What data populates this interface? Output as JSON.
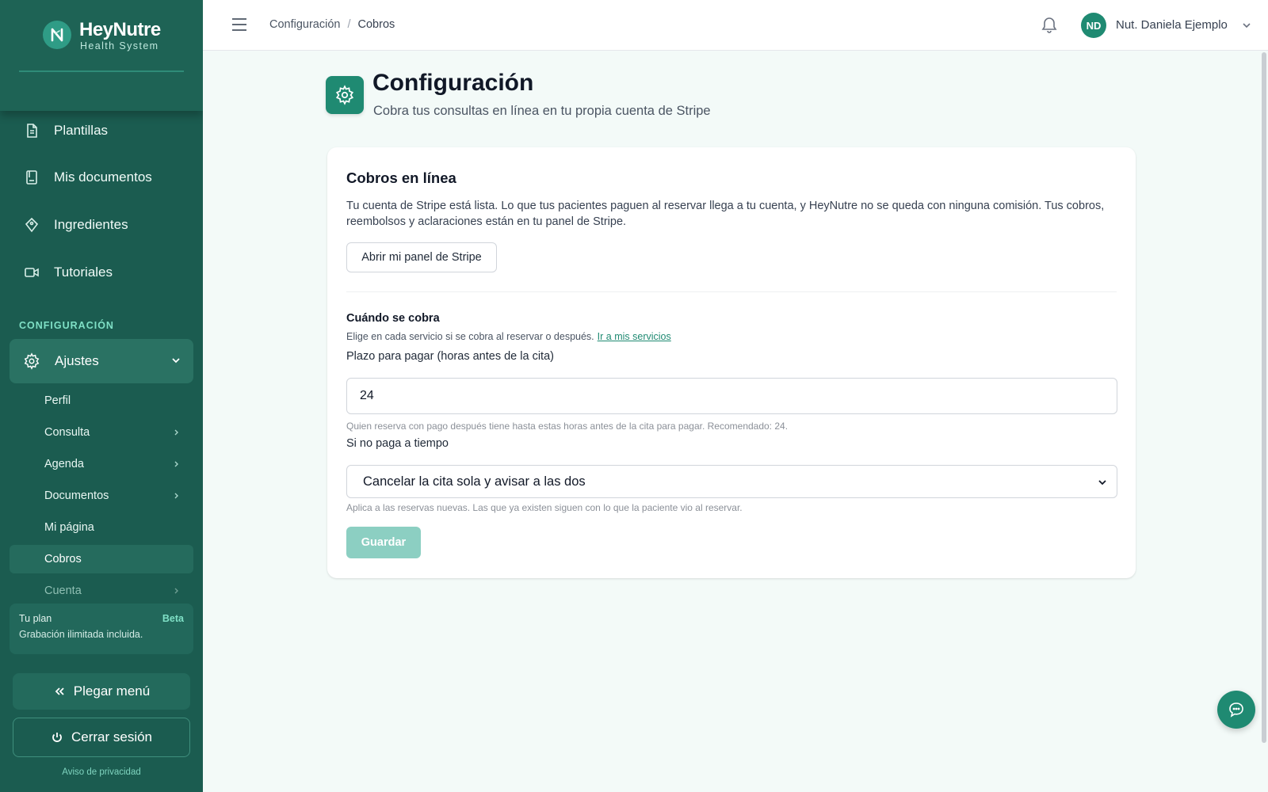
{
  "brand": {
    "name": "HeyNutre",
    "subtitle": "Health System"
  },
  "sidebar": {
    "items": [
      {
        "label": "Plantillas",
        "icon": "document-icon"
      },
      {
        "label": "Mis documentos",
        "icon": "book-icon"
      },
      {
        "label": "Ingredientes",
        "icon": "tag-icon"
      },
      {
        "label": "Tutoriales",
        "icon": "video-icon"
      }
    ],
    "section_label": "CONFIGURACIÓN",
    "settings": {
      "label": "Ajustes",
      "icon": "gear-icon",
      "expanded": true
    },
    "sub_items": [
      {
        "label": "Perfil",
        "has_arrow": false
      },
      {
        "label": "Consulta",
        "has_arrow": true
      },
      {
        "label": "Agenda",
        "has_arrow": true
      },
      {
        "label": "Documentos",
        "has_arrow": true
      },
      {
        "label": "Mi página",
        "has_arrow": false
      },
      {
        "label": "Cobros",
        "has_arrow": false,
        "active": true
      },
      {
        "label": "Cuenta",
        "has_arrow": true
      }
    ],
    "plan": {
      "title": "Tu plan",
      "badge": "Beta",
      "description": "Grabación ilimitada incluida."
    },
    "collapse_label": "Plegar menú",
    "logout_label": "Cerrar sesión",
    "privacy_label": "Aviso de privacidad"
  },
  "topbar": {
    "breadcrumb": [
      "Configuración",
      "Cobros"
    ],
    "breadcrumb_separator": "/",
    "user": {
      "initials": "ND",
      "name": "Nut. Daniela Ejemplo"
    }
  },
  "page": {
    "title": "Configuración",
    "subtitle": "Cobra tus consultas en línea en tu propia cuenta de Stripe"
  },
  "card": {
    "title": "Cobros en línea",
    "description": "Tu cuenta de Stripe está lista. Lo que tus pacientes paguen al reservar llega a tu cuenta, y HeyNutre no se queda con ninguna comisión. Tus cobros, reembolsos y aclaraciones están en tu panel de Stripe.",
    "stripe_button": "Abrir mi panel de Stripe",
    "when_title": "Cuándo se cobra",
    "when_desc": "Elige en cada servicio si se cobra al reservar o después.",
    "when_link": "Ir a mis servicios",
    "deadline_label": "Plazo para pagar (horas antes de la cita)",
    "deadline_value": "24",
    "deadline_hint": "Quien reserva con pago después tiene hasta estas horas antes de la cita para pagar. Recomendado: 24.",
    "late_label": "Si no paga a tiempo",
    "late_value": "Cancelar la cita sola y avisar a las dos",
    "late_hint": "Aplica a las reservas nuevas. Las que ya existen siguen con lo que la paciente vio al reservar.",
    "save_button": "Guardar"
  },
  "colors": {
    "sidebar": "#1b5c50",
    "accent": "#1f8a72",
    "accent_light": "#7fe0c6",
    "save_disabled": "#8ccfc2",
    "background": "#f3faf8"
  }
}
